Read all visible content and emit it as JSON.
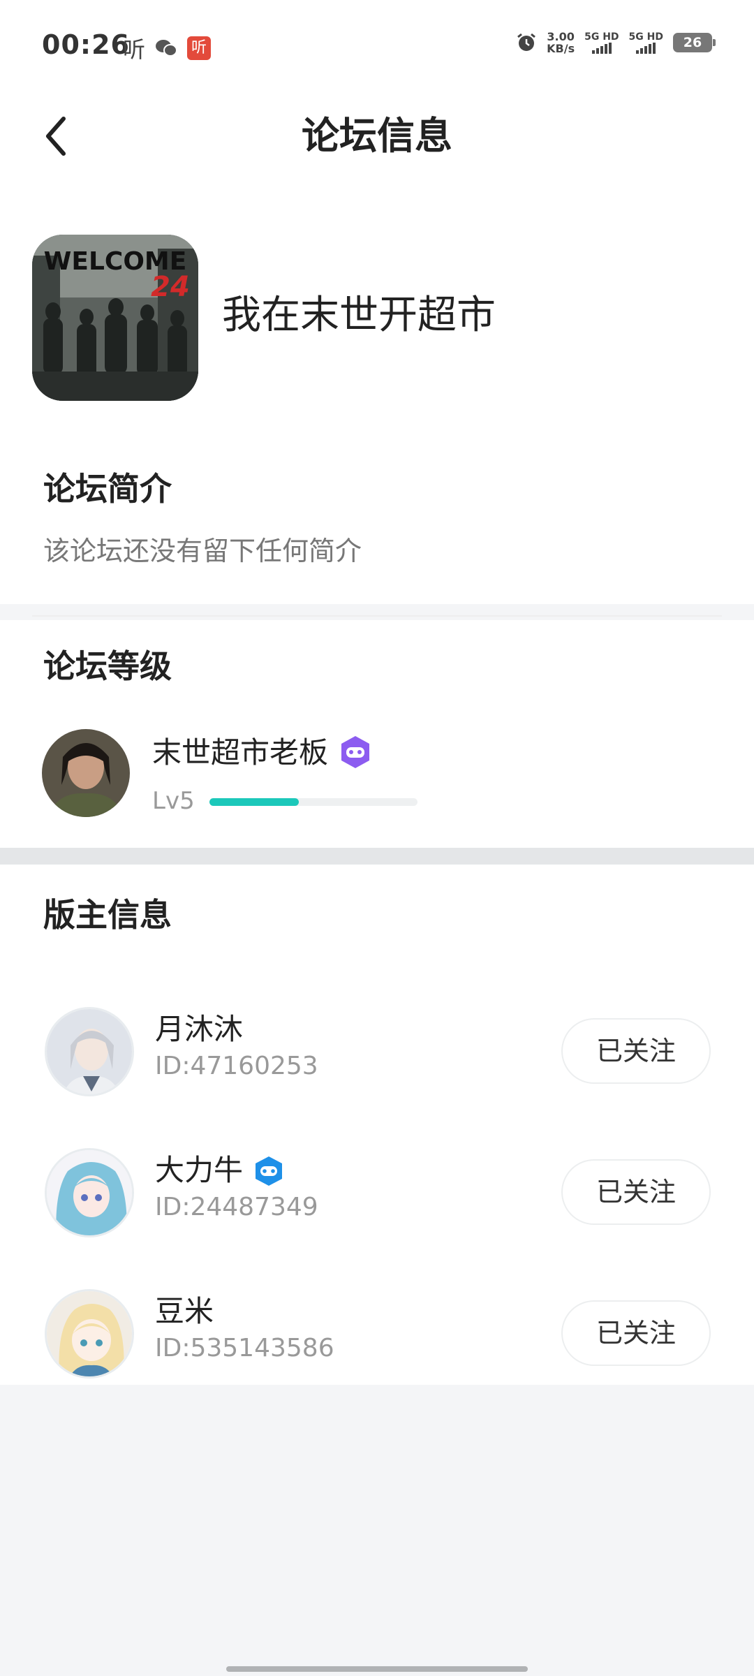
{
  "status_bar": {
    "time": "00:26",
    "ting_label": "听",
    "red_app_label": "听",
    "speed_value": "3.00",
    "speed_unit": "KB/s",
    "sim1_label": "5G HD",
    "sim2_label": "5G HD",
    "battery_level": "26"
  },
  "nav": {
    "title": "论坛信息"
  },
  "forum": {
    "cover_text": "WELCOME",
    "cover_number": "24",
    "name": "我在末世开超市",
    "intro_title": "论坛简介",
    "intro_text": "该论坛还没有留下任何简介"
  },
  "level": {
    "section_title": "论坛等级",
    "user_title": "末世超市老板",
    "level_label": "Lv5",
    "progress": 0.43,
    "progress_color": "#1cc8ba"
  },
  "moderators": {
    "section_title": "版主信息",
    "items": [
      {
        "name": "月沐沐",
        "id_text": "ID:47160253",
        "follow_label": "已关注",
        "has_badge": false
      },
      {
        "name": "大力牛",
        "id_text": "ID:24487349",
        "follow_label": "已关注",
        "has_badge": true
      },
      {
        "name": "豆米",
        "id_text": "ID:535143586",
        "follow_label": "已关注",
        "has_badge": false
      }
    ]
  }
}
